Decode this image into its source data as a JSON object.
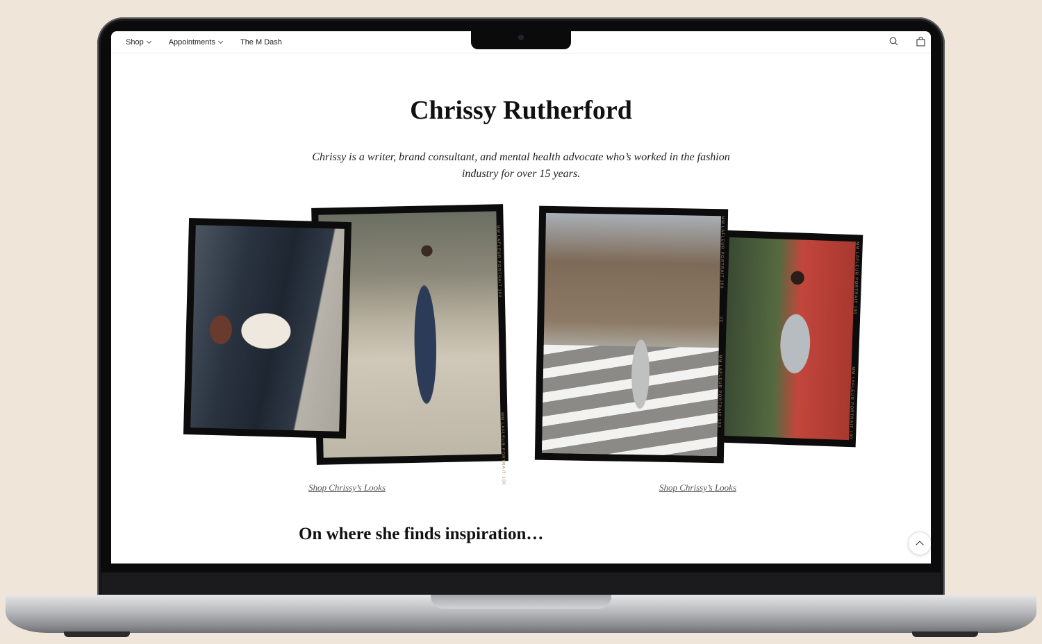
{
  "nav": {
    "items": [
      {
        "label": "Shop",
        "dropdown": true
      },
      {
        "label": "Appointments",
        "dropdown": true
      },
      {
        "label": "The M Dash",
        "dropdown": false
      }
    ],
    "icons": [
      "search-icon",
      "shopping-bag-icon"
    ]
  },
  "page": {
    "title": "Chrissy Rutherford",
    "intro": "Chrissy is a writer, brand consultant, and mental health advocate who’s worked in the fashion industry for over 15 years.",
    "shop_link_1": "Shop Chrissy’s Looks",
    "shop_link_2": "Shop Chrissy’s Looks",
    "section_heading": "On where she finds inspiration…"
  },
  "film": {
    "edge_label": "MM LAFLEUR PORTRAIT 100",
    "frame_numbers": [
      "21",
      "22"
    ]
  },
  "colors": {
    "background": "#efe5d8",
    "frame": "#0c0c0c",
    "text": "#111111"
  }
}
